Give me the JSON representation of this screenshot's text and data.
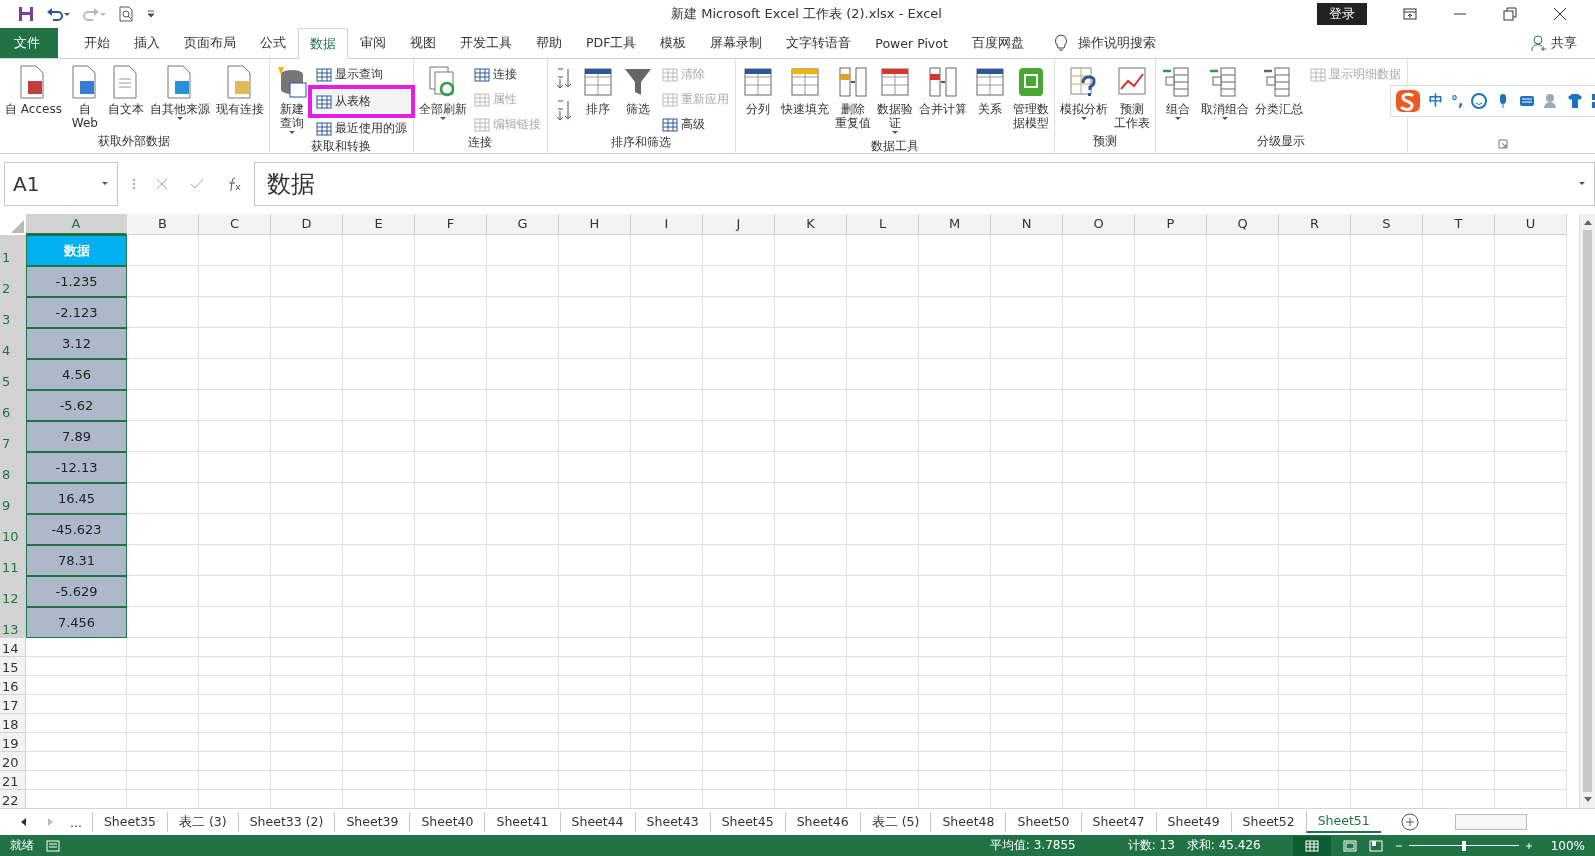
{
  "title_bar": {
    "title": "新建 Microsoft Excel 工作表 (2).xlsx  -  Excel",
    "login": "登录"
  },
  "menu": {
    "file": "文件",
    "tabs": [
      {
        "label": "开始",
        "selected": false
      },
      {
        "label": "插入",
        "selected": false
      },
      {
        "label": "页面布局",
        "selected": false
      },
      {
        "label": "公式",
        "selected": false
      },
      {
        "label": "数据",
        "selected": true
      },
      {
        "label": "审阅",
        "selected": false
      },
      {
        "label": "视图",
        "selected": false
      },
      {
        "label": "开发工具",
        "selected": false
      },
      {
        "label": "帮助",
        "selected": false
      },
      {
        "label": "PDF工具",
        "selected": false
      },
      {
        "label": "模板",
        "selected": false
      },
      {
        "label": "屏幕录制",
        "selected": false
      },
      {
        "label": "文字转语音",
        "selected": false
      },
      {
        "label": "Power Pivot",
        "selected": false
      },
      {
        "label": "百度网盘",
        "selected": false
      }
    ],
    "tell_me": "操作说明搜索",
    "share": "共享"
  },
  "ribbon": {
    "groups": [
      {
        "label": "获取外部数据",
        "items": [
          {
            "kind": "large",
            "lines": [
              "自 Access"
            ]
          },
          {
            "kind": "large",
            "lines": [
              "自",
              "Web"
            ]
          },
          {
            "kind": "large",
            "lines": [
              "自文本"
            ]
          },
          {
            "kind": "large",
            "lines": [
              "自其他来源"
            ],
            "dropdown": true
          },
          {
            "kind": "large",
            "lines": [
              "现有连接"
            ]
          }
        ]
      },
      {
        "label": "获取和转换",
        "items": [
          {
            "kind": "large",
            "lines": [
              "新建",
              "查询"
            ],
            "dropdown": true
          },
          {
            "kind": "stack",
            "entries": [
              {
                "label": "显示查询",
                "disabled": false,
                "highlighted": false
              },
              {
                "label": "从表格",
                "disabled": false,
                "highlighted": true
              },
              {
                "label": "最近使用的源",
                "disabled": false,
                "highlighted": false
              }
            ]
          }
        ]
      },
      {
        "label": "连接",
        "items": [
          {
            "kind": "large",
            "lines": [
              "全部刷新"
            ],
            "dropdown": true
          },
          {
            "kind": "stack",
            "entries": [
              {
                "label": "连接",
                "disabled": false,
                "highlighted": false
              },
              {
                "label": "属性",
                "disabled": true,
                "highlighted": false
              },
              {
                "label": "编辑链接",
                "disabled": true,
                "highlighted": false
              }
            ]
          }
        ]
      },
      {
        "label": "排序和筛选",
        "items": [
          {
            "kind": "sort"
          },
          {
            "kind": "large",
            "lines": [
              "排序"
            ]
          },
          {
            "kind": "large",
            "lines": [
              "筛选"
            ]
          },
          {
            "kind": "stack",
            "entries": [
              {
                "label": "清除",
                "disabled": true,
                "highlighted": false
              },
              {
                "label": "重新应用",
                "disabled": true,
                "highlighted": false
              },
              {
                "label": "高级",
                "disabled": false,
                "highlighted": false
              }
            ]
          }
        ]
      },
      {
        "label": "数据工具",
        "items": [
          {
            "kind": "large",
            "lines": [
              "分列"
            ]
          },
          {
            "kind": "large",
            "lines": [
              "快速填充"
            ]
          },
          {
            "kind": "large",
            "lines": [
              "删除",
              "重复值"
            ]
          },
          {
            "kind": "large",
            "lines": [
              "数据验",
              "证"
            ],
            "dropdown": true
          },
          {
            "kind": "large",
            "lines": [
              "合并计算"
            ]
          },
          {
            "kind": "large",
            "lines": [
              "关系"
            ]
          },
          {
            "kind": "large",
            "lines": [
              "管理数",
              "据模型"
            ]
          }
        ]
      },
      {
        "label": "预测",
        "items": [
          {
            "kind": "large",
            "lines": [
              "模拟分析"
            ],
            "dropdown": true
          },
          {
            "kind": "large",
            "lines": [
              "预测",
              "工作表"
            ]
          }
        ]
      },
      {
        "label": "分级显示",
        "items": [
          {
            "kind": "large",
            "lines": [
              "组合"
            ],
            "dropdown": true
          },
          {
            "kind": "large",
            "lines": [
              "取消组合"
            ],
            "dropdown": true
          },
          {
            "kind": "large",
            "lines": [
              "分类汇总"
            ]
          },
          {
            "kind": "stack",
            "entries": [
              {
                "label": "显示明细数据",
                "disabled": true,
                "highlighted": false
              }
            ]
          }
        ]
      }
    ]
  },
  "ime_toolbar": {
    "items": [
      "中",
      "°,"
    ]
  },
  "formula_bar": {
    "name_box": "A1",
    "formula": "数据"
  },
  "sheet": {
    "columns": [
      {
        "label": "A",
        "selected": true
      },
      {
        "label": "B",
        "selected": false
      },
      {
        "label": "C",
        "selected": false
      },
      {
        "label": "D",
        "selected": false
      },
      {
        "label": "E",
        "selected": false
      },
      {
        "label": "F",
        "selected": false
      },
      {
        "label": "G",
        "selected": false
      },
      {
        "label": "H",
        "selected": false
      },
      {
        "label": "I",
        "selected": false
      },
      {
        "label": "J",
        "selected": false
      },
      {
        "label": "K",
        "selected": false
      },
      {
        "label": "L",
        "selected": false
      },
      {
        "label": "M",
        "selected": false
      },
      {
        "label": "N",
        "selected": false
      },
      {
        "label": "O",
        "selected": false
      },
      {
        "label": "P",
        "selected": false
      },
      {
        "label": "Q",
        "selected": false
      },
      {
        "label": "R",
        "selected": false
      },
      {
        "label": "S",
        "selected": false
      },
      {
        "label": "T",
        "selected": false
      },
      {
        "label": "U",
        "selected": false
      }
    ],
    "rows": [
      {
        "header": "1",
        "selected": true,
        "cells": [
          {
            "kind": "title",
            "text": "数据"
          }
        ]
      },
      {
        "header": "2",
        "selected": true,
        "cells": [
          {
            "kind": "value",
            "text": "-1.235"
          }
        ]
      },
      {
        "header": "3",
        "selected": true,
        "cells": [
          {
            "kind": "value",
            "text": "-2.123"
          }
        ]
      },
      {
        "header": "4",
        "selected": true,
        "cells": [
          {
            "kind": "value",
            "text": "3.12"
          }
        ]
      },
      {
        "header": "5",
        "selected": true,
        "cells": [
          {
            "kind": "value",
            "text": "4.56"
          }
        ]
      },
      {
        "header": "6",
        "selected": true,
        "cells": [
          {
            "kind": "value",
            "text": "-5.62"
          }
        ]
      },
      {
        "header": "7",
        "selected": true,
        "cells": [
          {
            "kind": "value",
            "text": "7.89"
          }
        ]
      },
      {
        "header": "8",
        "selected": true,
        "cells": [
          {
            "kind": "value",
            "text": "-12.13"
          }
        ]
      },
      {
        "header": "9",
        "selected": true,
        "cells": [
          {
            "kind": "value",
            "text": "16.45"
          }
        ]
      },
      {
        "header": "10",
        "selected": true,
        "cells": [
          {
            "kind": "value",
            "text": "-45.623"
          }
        ]
      },
      {
        "header": "11",
        "selected": true,
        "cells": [
          {
            "kind": "value",
            "text": "78.31"
          }
        ]
      },
      {
        "header": "12",
        "selected": true,
        "cells": [
          {
            "kind": "value",
            "text": "-5.629"
          }
        ]
      },
      {
        "header": "13",
        "selected": true,
        "cells": [
          {
            "kind": "value",
            "text": "7.456"
          }
        ]
      },
      {
        "header": "14",
        "selected": false
      },
      {
        "header": "15",
        "selected": false
      },
      {
        "header": "16",
        "selected": false
      },
      {
        "header": "17",
        "selected": false
      },
      {
        "header": "18",
        "selected": false
      },
      {
        "header": "19",
        "selected": false
      },
      {
        "header": "20",
        "selected": false
      },
      {
        "header": "21",
        "selected": false
      },
      {
        "header": "22",
        "selected": false
      }
    ]
  },
  "sheet_tabs": {
    "more": "...",
    "tabs": [
      {
        "label": "Sheet35",
        "selected": false
      },
      {
        "label": "表二 (3)",
        "selected": false
      },
      {
        "label": "Sheet33 (2)",
        "selected": false
      },
      {
        "label": "Sheet39",
        "selected": false
      },
      {
        "label": "Sheet40",
        "selected": false
      },
      {
        "label": "Sheet41",
        "selected": false
      },
      {
        "label": "Sheet44",
        "selected": false
      },
      {
        "label": "Sheet43",
        "selected": false
      },
      {
        "label": "Sheet45",
        "selected": false
      },
      {
        "label": "Sheet46",
        "selected": false
      },
      {
        "label": "表二 (5)",
        "selected": false
      },
      {
        "label": "Sheet48",
        "selected": false
      },
      {
        "label": "Sheet50",
        "selected": false
      },
      {
        "label": "Sheet47",
        "selected": false
      },
      {
        "label": "Sheet49",
        "selected": false
      },
      {
        "label": "Sheet52",
        "selected": false
      },
      {
        "label": "Sheet51",
        "selected": true
      }
    ]
  },
  "status_bar": {
    "status": "就绪",
    "average": "平均值: 3.7855",
    "count": "计数: 13",
    "sum": "求和: 45.426",
    "zoom": "100%",
    "zoom_slider": {
      "level": 0.5
    }
  }
}
